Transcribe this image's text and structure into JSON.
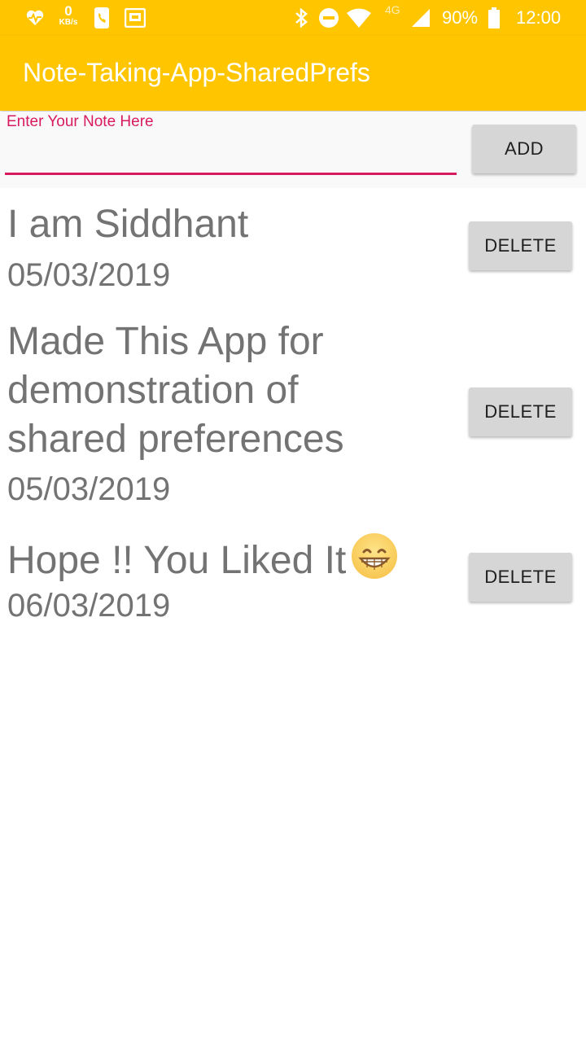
{
  "status_bar": {
    "speed_value": "0",
    "speed_unit": "KB/s",
    "network_label": "4G",
    "battery": "90%",
    "time": "12:00",
    "icons": [
      "heart-monitor-icon",
      "phone-icon",
      "cast-icon",
      "bluetooth-icon",
      "do-not-disturb-icon",
      "wifi-icon",
      "cell-signal-icon",
      "battery-icon"
    ]
  },
  "app_bar": {
    "title": "Note-Taking-App-SharedPrefs"
  },
  "input": {
    "label": "Enter Your Note Here",
    "value": "",
    "add_label": "ADD"
  },
  "notes": [
    {
      "lines": [
        "I am Siddhant"
      ],
      "date": "05/03/2019",
      "delete_label": "DELETE"
    },
    {
      "lines": [
        "Made This App for",
        "demonstration of",
        "shared preferences"
      ],
      "date": "05/03/2019",
      "delete_label": "DELETE"
    },
    {
      "lines": [
        "Hope !! You Liked It"
      ],
      "emoji": "grinning-face-icon",
      "date": "06/03/2019",
      "delete_label": "DELETE"
    }
  ],
  "colors": {
    "accent": "#ffc600",
    "input_underline": "#d81b60",
    "note_text": "#737373",
    "button_bg": "#d6d6d6"
  }
}
